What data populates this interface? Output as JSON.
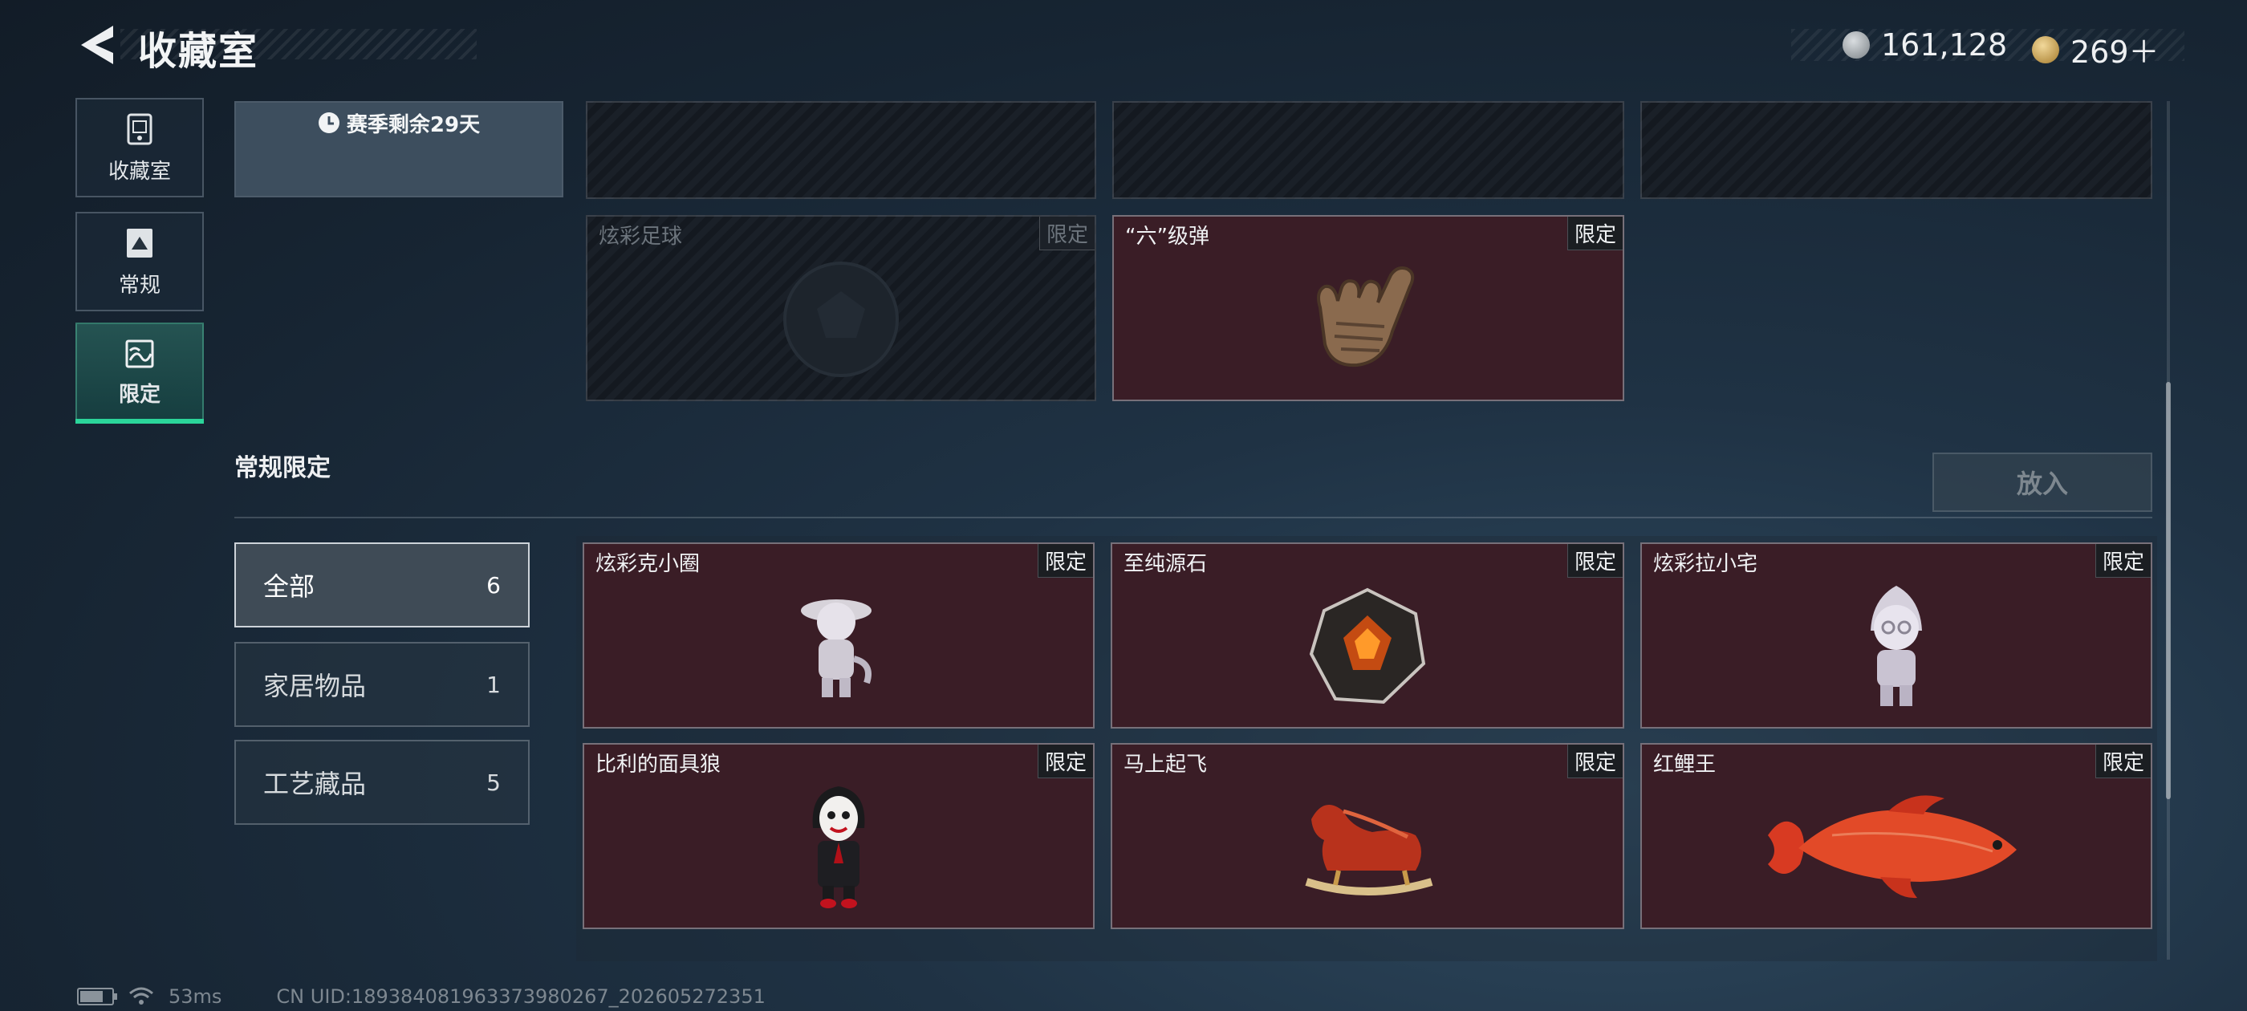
{
  "header": {
    "title": "收藏室",
    "currency_1": {
      "icon": "silver-coin-icon",
      "value": "161,128"
    },
    "currency_2": {
      "icon": "gold-coin-icon",
      "value": "269＋"
    }
  },
  "sidebar": {
    "items": [
      {
        "label": "收藏室",
        "icon": "trash-bin-icon"
      },
      {
        "label": "常规",
        "icon": "mountain-doc-icon"
      },
      {
        "label": "限定",
        "icon": "landscape-icon"
      }
    ]
  },
  "season": {
    "text": "赛季剩余29天"
  },
  "top_cards": [
    {
      "name": "",
      "tag": "",
      "locked": true
    },
    {
      "name": "",
      "tag": "",
      "locked": true
    },
    {
      "name": "",
      "tag": "",
      "locked": true
    },
    {
      "name": "炫彩足球",
      "tag": "限定",
      "locked": true
    },
    {
      "name": "“六”级弹",
      "tag": "限定",
      "locked": false
    }
  ],
  "section": {
    "title": "常规限定",
    "put_in_label": "放入"
  },
  "filters": [
    {
      "label": "全部",
      "count": "6"
    },
    {
      "label": "家居物品",
      "count": "1"
    },
    {
      "label": "工艺藏品",
      "count": "5"
    }
  ],
  "items": [
    {
      "name": "炫彩克小圈",
      "tag": "限定"
    },
    {
      "name": "至纯源石",
      "tag": "限定"
    },
    {
      "name": "炫彩拉小宅",
      "tag": "限定"
    },
    {
      "name": "比利的面具狼",
      "tag": "限定"
    },
    {
      "name": "马上起飞",
      "tag": "限定"
    },
    {
      "name": "红鲤王",
      "tag": "限定"
    }
  ],
  "footer": {
    "ping": "53ms",
    "uid": "CN UID:1893840819633739802​67_202605272351"
  },
  "colors": {
    "accent": "#2bd59a",
    "card_owned_bg": "#3a1d26",
    "background": "#1a2a3a"
  }
}
